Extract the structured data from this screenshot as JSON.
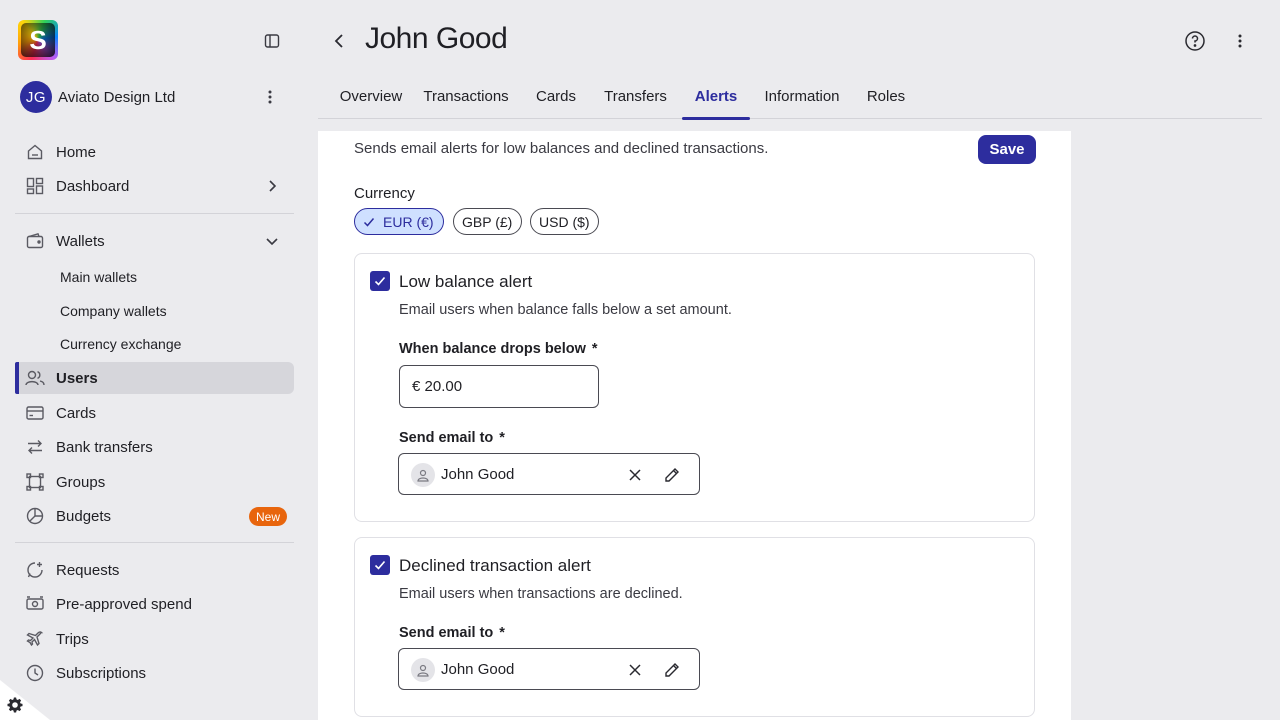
{
  "app": {
    "logo_letter": "S",
    "org_initials": "JG",
    "org_name": "Aviato Design Ltd"
  },
  "sidebar": {
    "items": [
      {
        "label": "Home",
        "icon": "home-icon"
      },
      {
        "label": "Dashboard",
        "icon": "dashboard-icon"
      },
      {
        "label": "Wallets",
        "icon": "wallet-icon"
      },
      {
        "label": "Users",
        "icon": "users-icon",
        "active": true
      },
      {
        "label": "Cards",
        "icon": "card-icon"
      },
      {
        "label": "Bank transfers",
        "icon": "transfer-icon"
      },
      {
        "label": "Groups",
        "icon": "groups-icon"
      },
      {
        "label": "Budgets",
        "icon": "budget-icon",
        "badge": "New"
      },
      {
        "label": "Requests",
        "icon": "requests-icon"
      },
      {
        "label": "Pre-approved spend",
        "icon": "preapproved-icon"
      },
      {
        "label": "Trips",
        "icon": "plane-icon"
      },
      {
        "label": "Subscriptions",
        "icon": "subscriptions-icon"
      }
    ],
    "wallet_sub_items": [
      "Main wallets",
      "Company wallets",
      "Currency exchange"
    ]
  },
  "header": {
    "title": "John Good"
  },
  "tabs": [
    {
      "label": "Overview"
    },
    {
      "label": "Transactions"
    },
    {
      "label": "Cards"
    },
    {
      "label": "Transfers"
    },
    {
      "label": "Alerts",
      "active": true
    },
    {
      "label": "Information"
    },
    {
      "label": "Roles"
    }
  ],
  "alerts": {
    "description": "Sends email alerts for low balances and declined transactions.",
    "save_label": "Save",
    "currency_label": "Currency",
    "currencies": [
      {
        "label": "EUR (€)",
        "selected": true
      },
      {
        "label": "GBP (£)",
        "selected": false
      },
      {
        "label": "USD ($)",
        "selected": false
      }
    ],
    "low_balance": {
      "title": "Low balance alert",
      "checked": true,
      "description": "Email users when balance falls below a set amount.",
      "threshold_label": "When balance drops below",
      "threshold_value": "€ 20.00",
      "email_label": "Send email to",
      "recipient": "John Good"
    },
    "declined": {
      "title": "Declined transaction alert",
      "checked": true,
      "description": "Email users when transactions are declined.",
      "email_label": "Send email to",
      "recipient": "John Good"
    },
    "required_mark": "*"
  },
  "colors": {
    "accent": "#2d2d9e",
    "badge": "#e8650d",
    "chip_selected": "#cfe0ff",
    "background": "#ebebee"
  }
}
